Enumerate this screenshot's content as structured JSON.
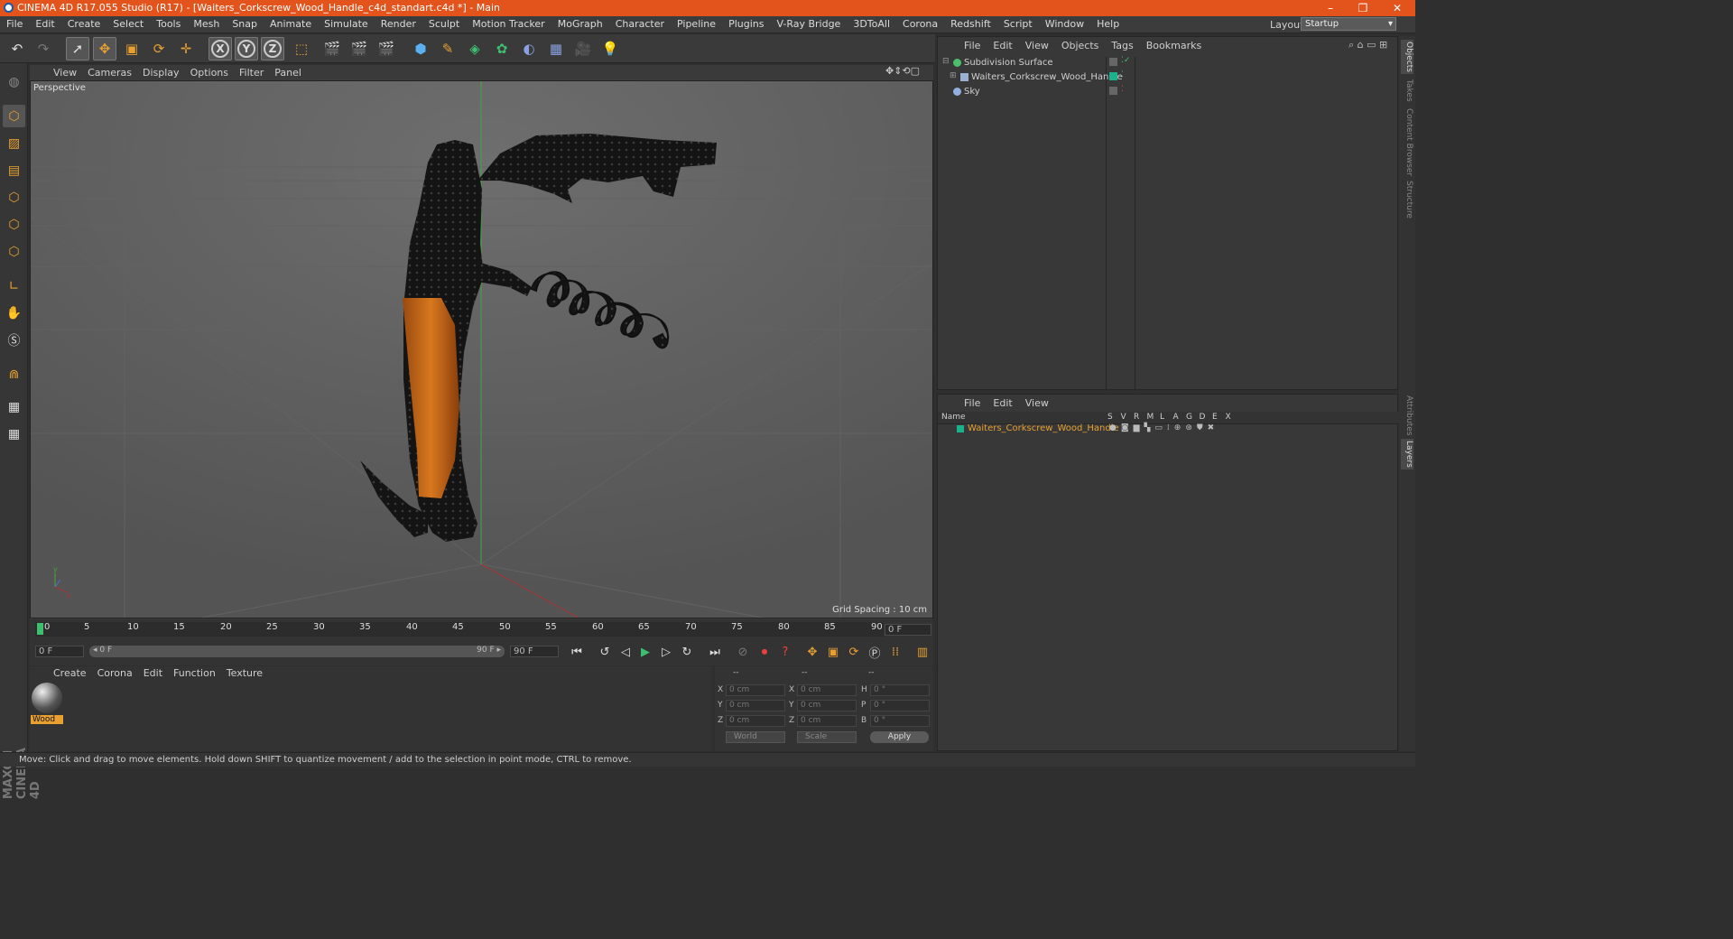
{
  "window": {
    "title": "CINEMA 4D R17.055 Studio (R17) - [Waiters_Corkscrew_Wood_Handle_c4d_standart.c4d *] - Main",
    "controls": [
      "–",
      "❐",
      "✕"
    ]
  },
  "menubar": {
    "items": [
      "File",
      "Edit",
      "Create",
      "Select",
      "Tools",
      "Mesh",
      "Snap",
      "Animate",
      "Simulate",
      "Render",
      "Sculpt",
      "Motion Tracker",
      "MoGraph",
      "Character",
      "Pipeline",
      "Plugins",
      "V-Ray Bridge",
      "3DToAll",
      "Corona",
      "Redshift",
      "Script",
      "Window",
      "Help"
    ],
    "layout_label": "Layout:",
    "layout_value": "Startup"
  },
  "viewport": {
    "menu": [
      "View",
      "Cameras",
      "Display",
      "Options",
      "Filter",
      "Panel"
    ],
    "camera_label": "Perspective",
    "grid_spacing": "Grid Spacing : 10 cm"
  },
  "timeline": {
    "ticks": [
      "0",
      "5",
      "10",
      "15",
      "20",
      "25",
      "30",
      "35",
      "40",
      "45",
      "50",
      "55",
      "60",
      "65",
      "70",
      "75",
      "80",
      "85",
      "90"
    ],
    "current_frame": "0 F",
    "start_field": "0 F",
    "range_start": "◂ 0 F",
    "range_end": "90 F ▸",
    "end_field": "90 F"
  },
  "material_manager": {
    "menu": [
      "Create",
      "Corona",
      "Edit",
      "Function",
      "Texture"
    ],
    "materials": [
      {
        "name": "Wood"
      }
    ]
  },
  "coordinates": {
    "headers": [
      "--",
      "--",
      "--"
    ],
    "rows": [
      {
        "axis1": "X",
        "v1": "0 cm",
        "axis2": "X",
        "v2": "0 cm",
        "axis3": "H",
        "v3": "0 °"
      },
      {
        "axis1": "Y",
        "v1": "0 cm",
        "axis2": "Y",
        "v2": "0 cm",
        "axis3": "P",
        "v3": "0 °"
      },
      {
        "axis1": "Z",
        "v1": "0 cm",
        "axis2": "Z",
        "v2": "0 cm",
        "axis3": "B",
        "v3": "0 °"
      }
    ],
    "space_dropdown": "World",
    "mode_dropdown": "Scale",
    "apply_label": "Apply"
  },
  "object_manager": {
    "menu": [
      "File",
      "Edit",
      "View",
      "Objects",
      "Tags",
      "Bookmarks"
    ],
    "objects": [
      {
        "name": "Subdivision Surface",
        "icon_color": "#4bbf6b"
      },
      {
        "name": "Waiters_Corkscrew_Wood_Handle",
        "icon_color": "#9ab0d0"
      },
      {
        "name": "Sky",
        "icon_color": "#8fb0e0"
      }
    ]
  },
  "layer_manager": {
    "menu": [
      "File",
      "Edit",
      "View"
    ],
    "name_header": "Name",
    "columns": [
      "S",
      "V",
      "R",
      "M",
      "L",
      "A",
      "G",
      "D",
      "E",
      "X"
    ],
    "layers": [
      {
        "name": "Waiters_Corkscrew_Wood_Handle",
        "color": "#19b28a"
      }
    ]
  },
  "right_tabs": [
    "Objects",
    "Takes",
    "Content Browser",
    "Structure",
    "Attributes",
    "Layers"
  ],
  "status_text": "Move: Click and drag to move elements. Hold down SHIFT to quantize movement / add to the selection in point mode, CTRL to remove.",
  "branding": "MAXON CINEMA 4D"
}
